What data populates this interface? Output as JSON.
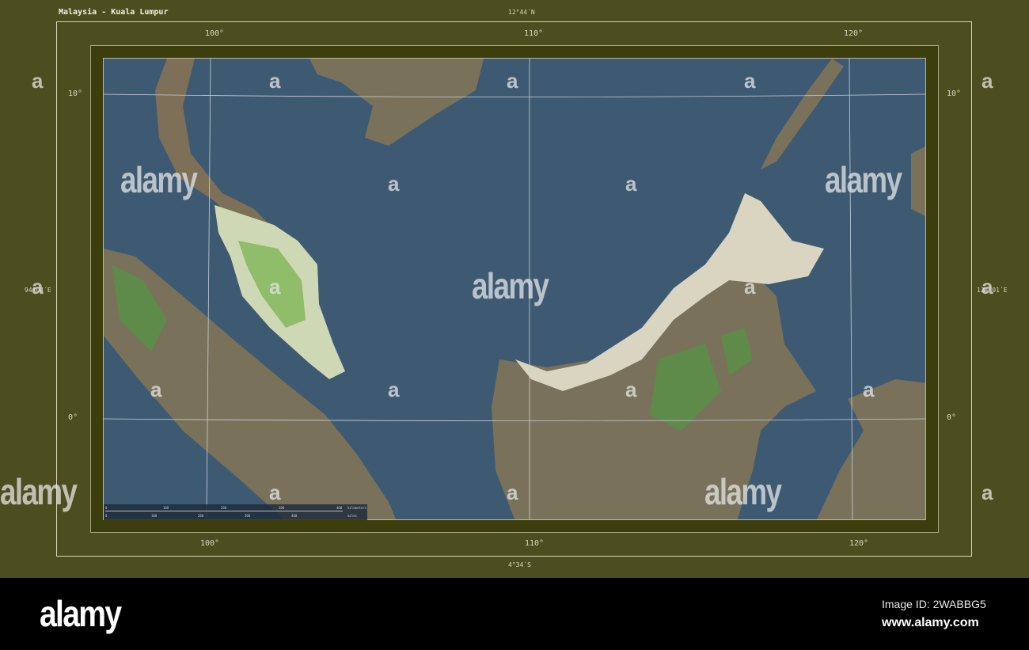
{
  "title": "Malaysia - Kuala Lumpur",
  "extent": {
    "north": "12°44´N",
    "south": "4°34´S",
    "west": "94°04´E",
    "east": "124°01´E"
  },
  "graticule": {
    "longitudes": [
      "100°",
      "110°",
      "120°"
    ],
    "latitudes": [
      "10°",
      "0°"
    ]
  },
  "scale_bar": {
    "km_ticks": [
      "0",
      "100",
      "200",
      "300",
      "400"
    ],
    "km_unit": "kilometers",
    "mi_ticks": [
      "0",
      "100",
      "200",
      "300",
      "400"
    ],
    "mi_unit": "miles"
  },
  "watermark": {
    "big": "alamy",
    "small": "a"
  },
  "footer": {
    "logo": "alamy",
    "image_id": "Image ID: 2WABBG5",
    "site": "www.alamy.com"
  },
  "colors": {
    "frame": "#4c4e1f",
    "water": "#3e5a73",
    "land": "#7a715a",
    "highlight": "#d9d5c0",
    "forest": "#5e8a4a"
  }
}
